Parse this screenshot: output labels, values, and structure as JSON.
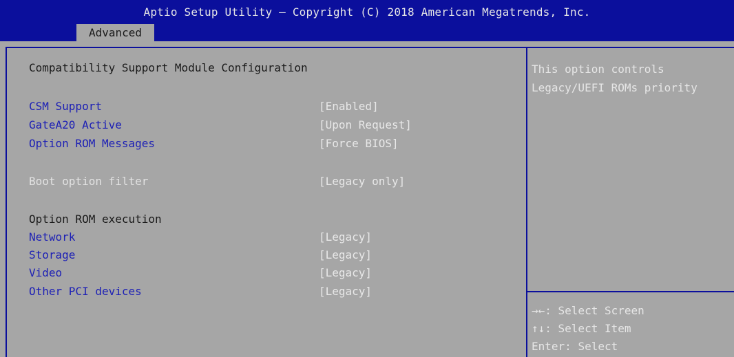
{
  "header": {
    "title": "Aptio Setup Utility – Copyright (C) 2018 American Megatrends, Inc.",
    "tab": "Advanced"
  },
  "main": {
    "section_title": "Compatibility Support Module Configuration",
    "settings": [
      {
        "label": "CSM Support",
        "value": "[Enabled]"
      },
      {
        "label": "GateA20 Active",
        "value": "[Upon Request]"
      },
      {
        "label": "Option ROM Messages",
        "value": "[Force BIOS]"
      }
    ],
    "boot_filter": {
      "label": "Boot option filter",
      "value": "[Legacy only]"
    },
    "rom_exec_heading": "Option ROM execution",
    "rom_exec": [
      {
        "label": "Network",
        "value": "[Legacy]"
      },
      {
        "label": "Storage",
        "value": "[Legacy]"
      },
      {
        "label": "Video",
        "value": "[Legacy]"
      },
      {
        "label": "Other PCI devices",
        "value": "[Legacy]"
      }
    ]
  },
  "help": {
    "lines": [
      "This option controls",
      "Legacy/UEFI ROMs priority"
    ]
  },
  "hotkeys": [
    {
      "key": "→←",
      "desc": ": Select Screen"
    },
    {
      "key": "↑↓",
      "desc": ": Select Item"
    },
    {
      "key": "Enter",
      "desc": ": Select"
    }
  ],
  "colors": {
    "background": "#a6a6a6",
    "header": "#0b0f9c",
    "option_label": "#1d20b5",
    "value_text": "#e8e8e8"
  }
}
